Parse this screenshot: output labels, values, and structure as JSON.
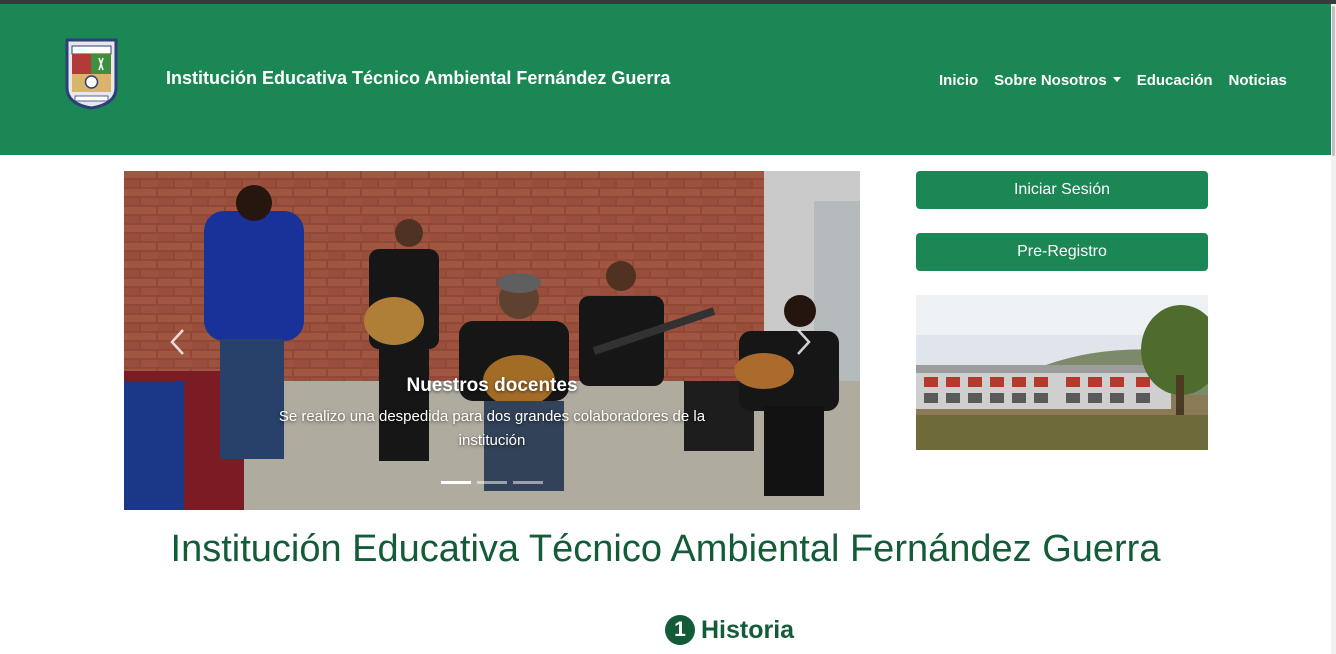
{
  "header": {
    "site_title": "Institución Educativa Técnico Ambiental Fernández Guerra",
    "logo_name": "school-crest-logo",
    "nav": {
      "inicio": "Inicio",
      "sobre": "Sobre Nosotros",
      "educacion": "Educación",
      "noticias": "Noticias"
    }
  },
  "carousel": {
    "slide_title": "Nuestros docentes",
    "slide_text": "Se realizo una despedida para dos grandes colaboradores de la institución",
    "slide_count": 3,
    "active_slide": 1
  },
  "sidebar": {
    "login_label": "Iniciar Sesión",
    "register_label": "Pre-Registro"
  },
  "main": {
    "title": "Institución Educativa Técnico Ambiental Fernández Guerra",
    "section_number": "1",
    "section_title": "Historia"
  },
  "colors": {
    "brand_green": "#1a8754",
    "dark_green": "#145c38"
  }
}
